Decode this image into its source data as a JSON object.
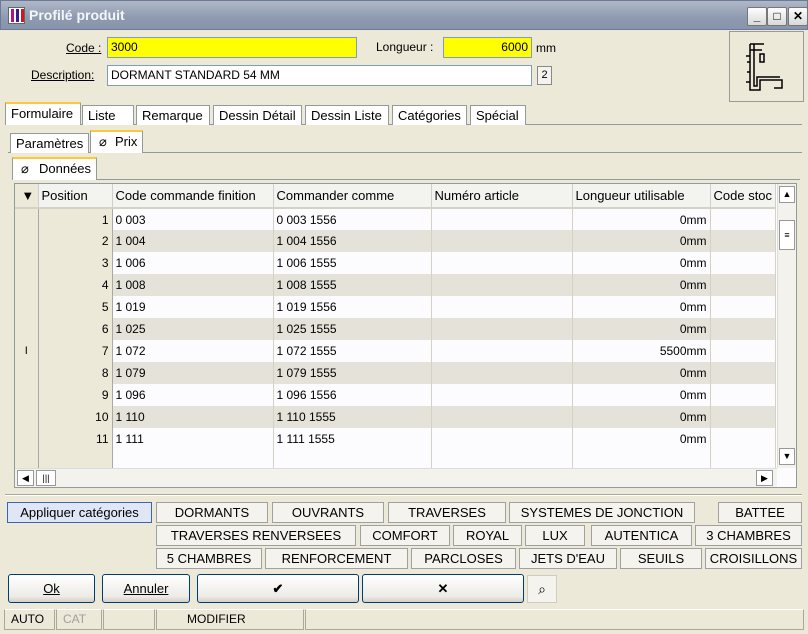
{
  "window": {
    "title": "Profilé produit"
  },
  "form": {
    "code_label": "Code :",
    "code_value": "3000",
    "length_label": "Longueur :",
    "length_value": "6000",
    "length_unit": "mm",
    "desc_label": "Description:",
    "desc_value": "DORMANT STANDARD 54 MM",
    "desc_count": "2"
  },
  "tabs": [
    "Formulaire",
    "Liste",
    "Remarque",
    "Dessin Détail",
    "Dessin Liste",
    "Catégories",
    "Spécial"
  ],
  "subtabs": [
    "Paramètres",
    "Prix"
  ],
  "section_tab": "Données",
  "grid": {
    "columns": [
      "Position",
      "Code commande finition",
      "Commander comme",
      "Numéro article",
      "Longueur utilisable",
      "Code stoc"
    ],
    "rows": [
      {
        "position": "1",
        "code": "0 003",
        "commander": "0 003 1556",
        "article": "",
        "longueur": "0mm"
      },
      {
        "position": "2",
        "code": "1 004",
        "commander": "1 004 1556",
        "article": "",
        "longueur": "0mm"
      },
      {
        "position": "3",
        "code": "1 006",
        "commander": "1 006 1555",
        "article": "",
        "longueur": "0mm"
      },
      {
        "position": "4",
        "code": "1 008",
        "commander": "1 008 1555",
        "article": "",
        "longueur": "0mm"
      },
      {
        "position": "5",
        "code": "1 019",
        "commander": "1 019 1556",
        "article": "",
        "longueur": "0mm"
      },
      {
        "position": "6",
        "code": "1 025",
        "commander": "1 025 1555",
        "article": "",
        "longueur": "0mm"
      },
      {
        "position": "7",
        "code": "1 072",
        "commander": "1 072 1555",
        "article": "",
        "longueur": "5500mm"
      },
      {
        "position": "8",
        "code": "1 079",
        "commander": "1 079 1555",
        "article": "",
        "longueur": "0mm"
      },
      {
        "position": "9",
        "code": "1 096",
        "commander": "1 096 1556",
        "article": "",
        "longueur": "0mm"
      },
      {
        "position": "10",
        "code": "1 110",
        "commander": "1 110 1555",
        "article": "",
        "longueur": "0mm"
      },
      {
        "position": "11",
        "code": "1 111",
        "commander": "1 111 1555",
        "article": "",
        "longueur": "0mm"
      }
    ]
  },
  "categories": {
    "apply_label": "Appliquer catégories",
    "row1": [
      "DORMANTS",
      "OUVRANTS",
      "TRAVERSES",
      "SYSTEMES DE JONCTION",
      "BATTEE"
    ],
    "row2": [
      "TRAVERSES RENVERSEES",
      "COMFORT",
      "ROYAL",
      "LUX",
      "AUTENTICA",
      "3 CHAMBRES"
    ],
    "row3": [
      "5 CHAMBRES",
      "RENFORCEMENT",
      "PARCLOSES",
      "JETS D'EAU",
      "SEUILS",
      "CROISILLONS"
    ]
  },
  "buttons": {
    "ok": "Ok",
    "cancel": "Annuler",
    "confirm": "✔",
    "reject": "✕"
  },
  "status": {
    "auto": "AUTO",
    "cat": "CAT",
    "mode": "MODIFIER"
  },
  "colors": {
    "title_bar": "#8e9ab0",
    "required_field": "#ffff00",
    "tab_accent": "#ffc83c"
  }
}
